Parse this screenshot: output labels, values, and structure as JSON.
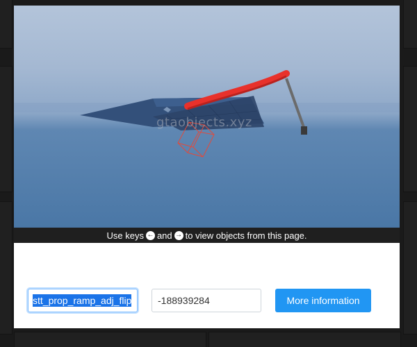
{
  "preview": {
    "watermark": "gtaobjects.xyz"
  },
  "hint": {
    "prefix": "Use keys",
    "left_key": "←",
    "middle": "and",
    "right_key": "→",
    "suffix": "to view objects from this page."
  },
  "object": {
    "name_value": "stt_prop_ramp_adj_flip",
    "hash_value": "-188939284"
  },
  "actions": {
    "more_info_label": "More information"
  },
  "colors": {
    "button": "#2196f3",
    "selection": "#1a73e8",
    "ramp_red": "#e8312b",
    "ramp_blue": "#33507a"
  }
}
